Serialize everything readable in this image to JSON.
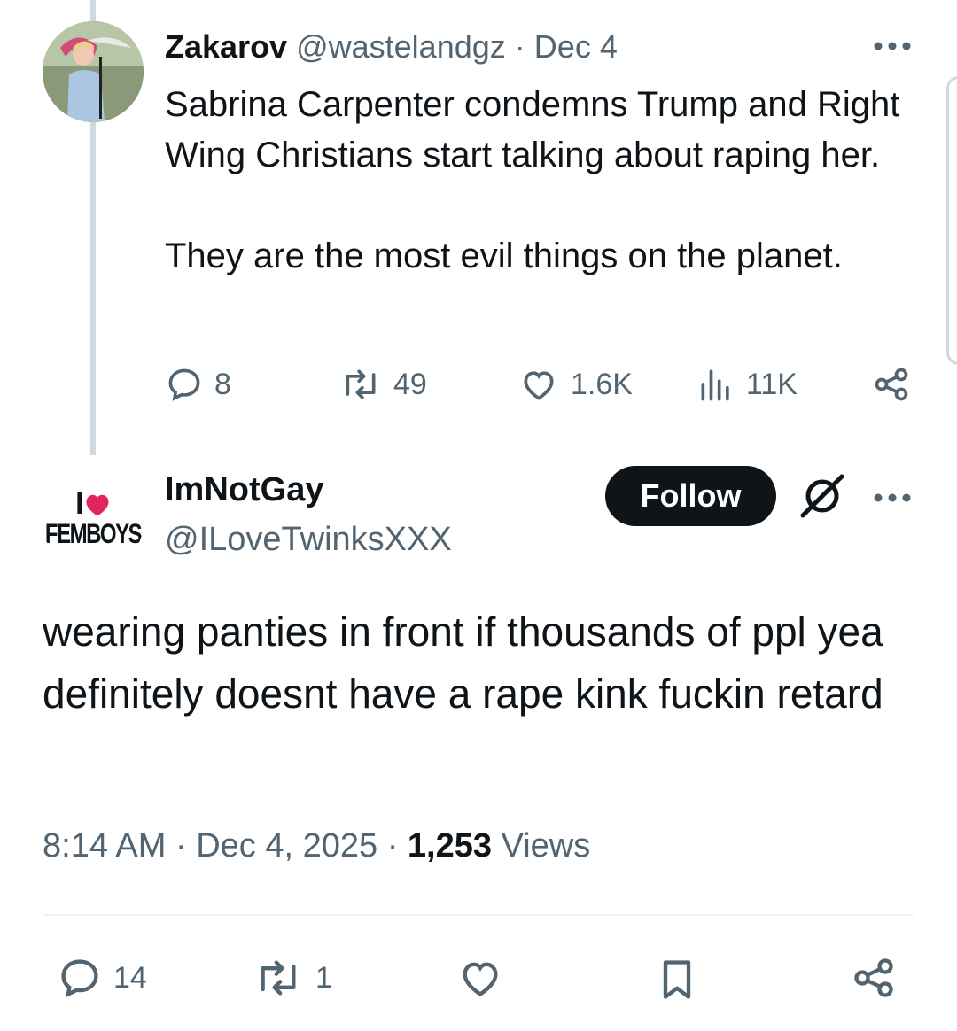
{
  "reply_context": {
    "author_name": "Zakarov",
    "handle": "@wastelandgz",
    "separator": "·",
    "date": "Dec 4",
    "text_paragraphs": [
      "Sabrina Carpenter condemns Trump and Right Wing Christians start talking about raping her.",
      "They are the most evil things on the planet."
    ],
    "stats": {
      "replies": "8",
      "reposts": "49",
      "likes": "1.6K",
      "views": "11K"
    }
  },
  "main_post": {
    "author_name": "ImNotGay",
    "handle": "@ILoveTwinksXXX",
    "follow_label": "Follow",
    "avatar_text": {
      "line1": "I",
      "line2": "FEMBOYS"
    },
    "text": "wearing panties in front if thousands of ppl yea definitely doesnt have a rape kink fuckin retard",
    "time": "8:14 AM",
    "date": "Dec 4, 2025",
    "separator": "·",
    "views_count": "1,253",
    "views_label": "Views",
    "stats": {
      "replies": "14",
      "reposts": "1"
    }
  },
  "colors": {
    "text": "#0f1419",
    "muted": "#536471",
    "thread_line": "#cfd9de",
    "heart_red": "#e0245e"
  }
}
